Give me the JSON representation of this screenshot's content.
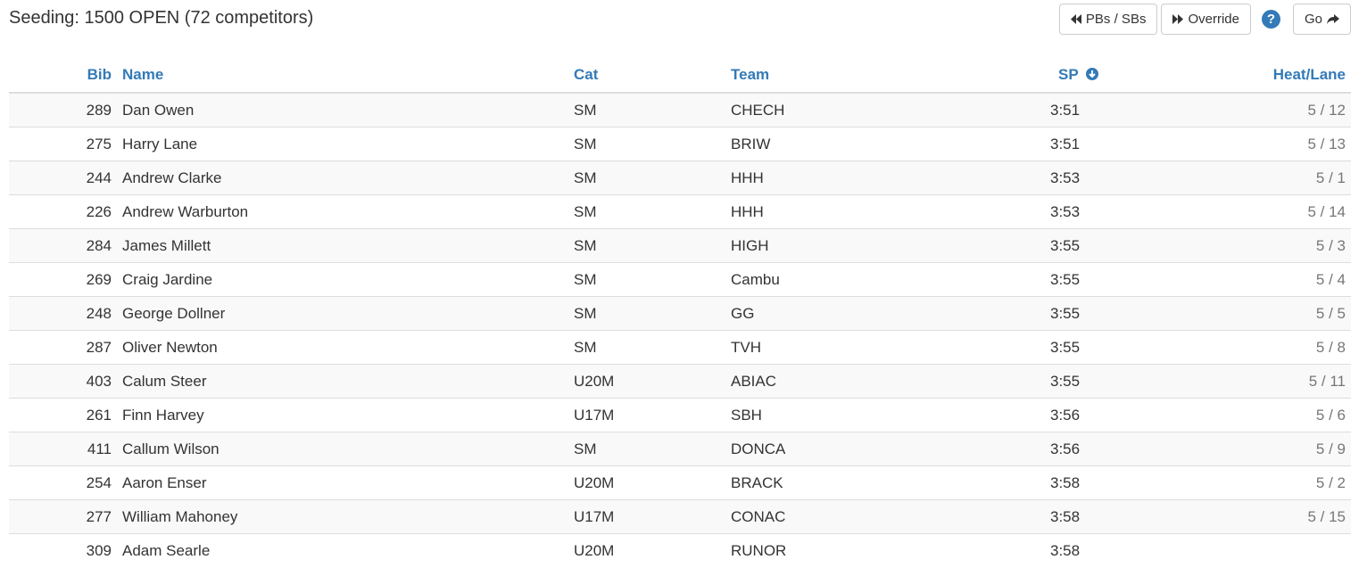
{
  "header": {
    "title": "Seeding: 1500 OPEN (72 competitors)"
  },
  "toolbar": {
    "pbs_label": "PBs / SBs",
    "override_label": "Override",
    "help_label": "?",
    "go_label": "Go"
  },
  "columns": {
    "bib": "Bib",
    "name": "Name",
    "cat": "Cat",
    "team": "Team",
    "sp": "SP",
    "heat": "Heat/Lane"
  },
  "colors": {
    "link": "#337ab7",
    "muted": "#777777",
    "stripe": "#f9f9f9"
  },
  "rows": [
    {
      "bib": "289",
      "name": "Dan Owen",
      "cat": "SM",
      "team": "CHECH",
      "sp": "3:51",
      "heat": "5 / 12"
    },
    {
      "bib": "275",
      "name": "Harry Lane",
      "cat": "SM",
      "team": "BRIW",
      "sp": "3:51",
      "heat": "5 / 13"
    },
    {
      "bib": "244",
      "name": "Andrew Clarke",
      "cat": "SM",
      "team": "HHH",
      "sp": "3:53",
      "heat": "5 / 1"
    },
    {
      "bib": "226",
      "name": "Andrew Warburton",
      "cat": "SM",
      "team": "HHH",
      "sp": "3:53",
      "heat": "5 / 14"
    },
    {
      "bib": "284",
      "name": "James Millett",
      "cat": "SM",
      "team": "HIGH",
      "sp": "3:55",
      "heat": "5 / 3"
    },
    {
      "bib": "269",
      "name": "Craig Jardine",
      "cat": "SM",
      "team": "Cambu",
      "sp": "3:55",
      "heat": "5 / 4"
    },
    {
      "bib": "248",
      "name": "George Dollner",
      "cat": "SM",
      "team": "GG",
      "sp": "3:55",
      "heat": "5 / 5"
    },
    {
      "bib": "287",
      "name": "Oliver Newton",
      "cat": "SM",
      "team": "TVH",
      "sp": "3:55",
      "heat": "5 / 8"
    },
    {
      "bib": "403",
      "name": "Calum Steer",
      "cat": "U20M",
      "team": "ABIAC",
      "sp": "3:55",
      "heat": "5 / 11"
    },
    {
      "bib": "261",
      "name": "Finn Harvey",
      "cat": "U17M",
      "team": "SBH",
      "sp": "3:56",
      "heat": "5 / 6"
    },
    {
      "bib": "411",
      "name": "Callum Wilson",
      "cat": "SM",
      "team": "DONCA",
      "sp": "3:56",
      "heat": "5 / 9"
    },
    {
      "bib": "254",
      "name": "Aaron Enser",
      "cat": "U20M",
      "team": "BRACK",
      "sp": "3:58",
      "heat": "5 / 2"
    },
    {
      "bib": "277",
      "name": "William Mahoney",
      "cat": "U17M",
      "team": "CONAC",
      "sp": "3:58",
      "heat": "5 / 15"
    },
    {
      "bib": "309",
      "name": "Adam Searle",
      "cat": "U20M",
      "team": "RUNOR",
      "sp": "3:58",
      "heat": ""
    }
  ]
}
